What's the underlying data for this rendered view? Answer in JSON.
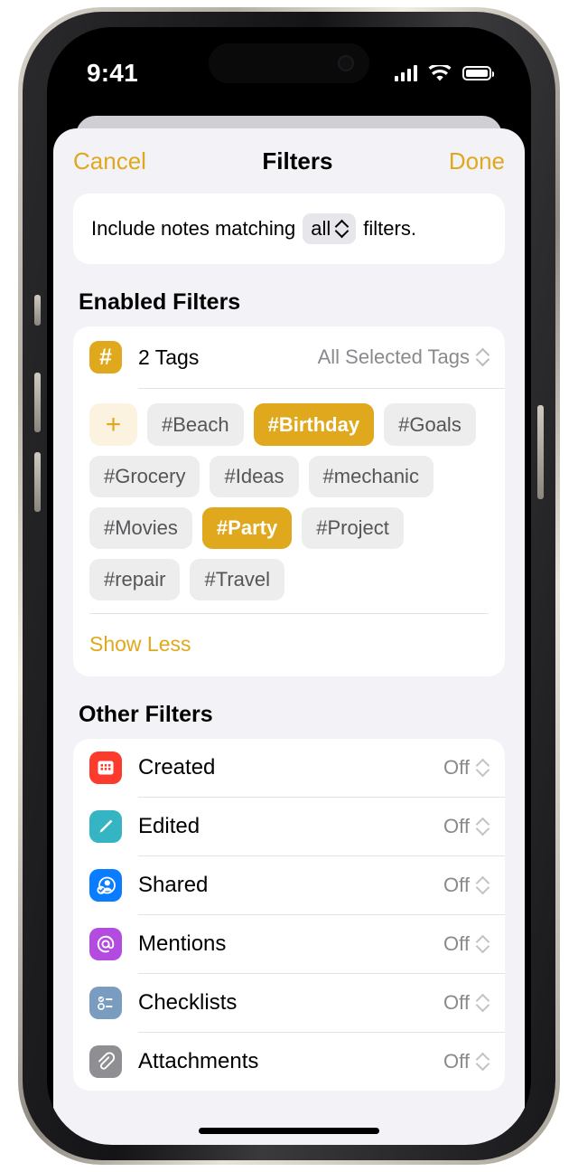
{
  "statusbar": {
    "time": "9:41",
    "signal_icon": "cellular-bars-icon",
    "wifi_icon": "wifi-icon",
    "battery_icon": "battery-full-icon"
  },
  "navbar": {
    "cancel_label": "Cancel",
    "title": "Filters",
    "done_label": "Done"
  },
  "match_row": {
    "prefix": "Include notes matching",
    "selected_value": "all",
    "suffix": "filters."
  },
  "enabled_filters": {
    "section_title": "Enabled Filters",
    "tags": {
      "icon": "hash-icon",
      "label": "2 Tags",
      "value": "All Selected Tags",
      "add_button_label": "+"
    },
    "chips": [
      {
        "label": "#Beach",
        "selected": false
      },
      {
        "label": "#Birthday",
        "selected": true
      },
      {
        "label": "#Goals",
        "selected": false
      },
      {
        "label": "#Grocery",
        "selected": false
      },
      {
        "label": "#Ideas",
        "selected": false
      },
      {
        "label": "#mechanic",
        "selected": false
      },
      {
        "label": "#Movies",
        "selected": false
      },
      {
        "label": "#Party",
        "selected": true
      },
      {
        "label": "#Project",
        "selected": false
      },
      {
        "label": "#repair",
        "selected": false
      },
      {
        "label": "#Travel",
        "selected": false
      }
    ],
    "show_less_label": "Show Less"
  },
  "other_filters": {
    "section_title": "Other Filters",
    "rows": [
      {
        "label": "Created",
        "value": "Off",
        "icon": "calendar-icon",
        "icon_color": "#FC3B2D"
      },
      {
        "label": "Edited",
        "value": "Off",
        "icon": "pencil-icon",
        "icon_color": "#35B5C4"
      },
      {
        "label": "Shared",
        "value": "Off",
        "icon": "person-badge-icon",
        "icon_color": "#0A7CFF"
      },
      {
        "label": "Mentions",
        "value": "Off",
        "icon": "at-sign-icon",
        "icon_color": "#B34BE0"
      },
      {
        "label": "Checklists",
        "value": "Off",
        "icon": "checklist-icon",
        "icon_color": "#7A9CC0"
      },
      {
        "label": "Attachments",
        "value": "Off",
        "icon": "paperclip-icon",
        "icon_color": "#8E8E93"
      }
    ]
  },
  "colors": {
    "accent": "#E0A81C",
    "sheet_background": "#F2F2F7",
    "card_background": "#FFFFFF",
    "chip_background": "#EDEDED"
  }
}
